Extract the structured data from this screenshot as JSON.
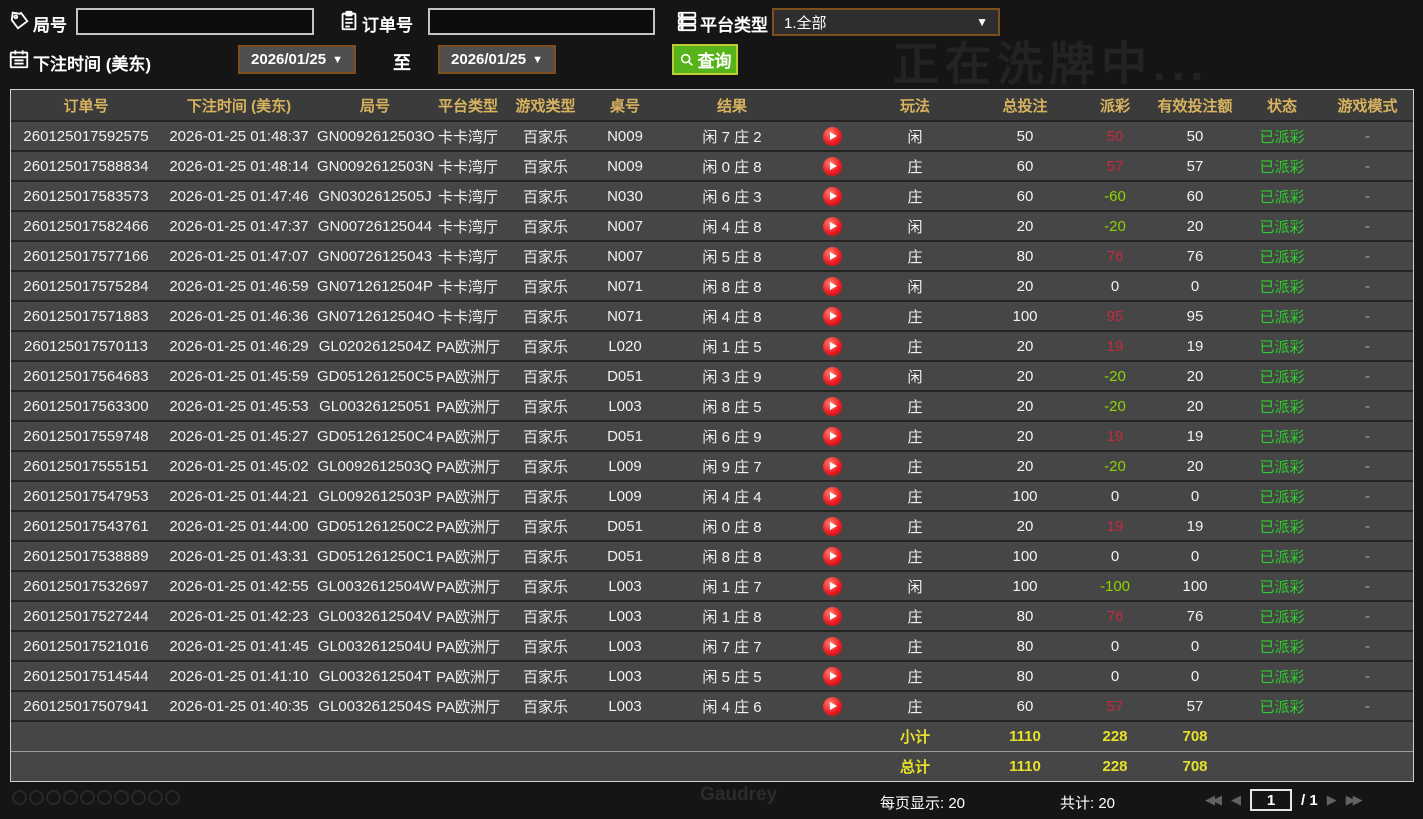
{
  "colors": {
    "positive_payout": "#c62a3e",
    "negative_payout": "#8fd400",
    "status_paid": "#2ecc2e",
    "totals": "#e8e12b",
    "header_text": "#d8b35f",
    "query_button": "#57b31a"
  },
  "watermarks": {
    "top": "正在洗牌中...",
    "bottom": "Gaudrey"
  },
  "filters": {
    "game_no_label": "局号",
    "order_no_label": "订单号",
    "platform_label": "平台类型",
    "platform_value": "1.全部",
    "bet_time_label": "下注时间 (美东)",
    "date_from": "2026/01/25",
    "date_to": "2026/01/25",
    "to_label": "至",
    "query_label": "查询"
  },
  "table": {
    "headers": [
      "订单号",
      "下注时间 (美东)",
      "局号",
      "平台类型",
      "游戏类型",
      "桌号",
      "结果",
      "",
      "玩法",
      "总投注",
      "派彩",
      "有效投注额",
      "状态",
      "游戏模式"
    ],
    "rows": [
      {
        "order_no": "260125017592575",
        "bet_time": "2026-01-25 01:48:37",
        "game_no": "GN0092612503O",
        "platform": "卡卡湾厅",
        "game_type": "百家乐",
        "table_no": "N009",
        "result": "闲 7 庄 2",
        "play": "闲",
        "total_bet": "50",
        "payout": "50",
        "payout_sign": "pos",
        "valid_bet": "50",
        "status": "已派彩",
        "game_mode": "-"
      },
      {
        "order_no": "260125017588834",
        "bet_time": "2026-01-25 01:48:14",
        "game_no": "GN0092612503N",
        "platform": "卡卡湾厅",
        "game_type": "百家乐",
        "table_no": "N009",
        "result": "闲 0 庄 8",
        "play": "庄",
        "total_bet": "60",
        "payout": "57",
        "payout_sign": "pos",
        "valid_bet": "57",
        "status": "已派彩",
        "game_mode": "-"
      },
      {
        "order_no": "260125017583573",
        "bet_time": "2026-01-25 01:47:46",
        "game_no": "GN0302612505J",
        "platform": "卡卡湾厅",
        "game_type": "百家乐",
        "table_no": "N030",
        "result": "闲 6 庄 3",
        "play": "庄",
        "total_bet": "60",
        "payout": "-60",
        "payout_sign": "neg",
        "valid_bet": "60",
        "status": "已派彩",
        "game_mode": "-"
      },
      {
        "order_no": "260125017582466",
        "bet_time": "2026-01-25 01:47:37",
        "game_no": "GN00726125044",
        "platform": "卡卡湾厅",
        "game_type": "百家乐",
        "table_no": "N007",
        "result": "闲 4 庄 8",
        "play": "闲",
        "total_bet": "20",
        "payout": "-20",
        "payout_sign": "neg",
        "valid_bet": "20",
        "status": "已派彩",
        "game_mode": "-"
      },
      {
        "order_no": "260125017577166",
        "bet_time": "2026-01-25 01:47:07",
        "game_no": "GN00726125043",
        "platform": "卡卡湾厅",
        "game_type": "百家乐",
        "table_no": "N007",
        "result": "闲 5 庄 8",
        "play": "庄",
        "total_bet": "80",
        "payout": "76",
        "payout_sign": "pos",
        "valid_bet": "76",
        "status": "已派彩",
        "game_mode": "-"
      },
      {
        "order_no": "260125017575284",
        "bet_time": "2026-01-25 01:46:59",
        "game_no": "GN0712612504P",
        "platform": "卡卡湾厅",
        "game_type": "百家乐",
        "table_no": "N071",
        "result": "闲 8 庄 8",
        "play": "闲",
        "total_bet": "20",
        "payout": "0",
        "payout_sign": "zero",
        "valid_bet": "0",
        "status": "已派彩",
        "game_mode": "-"
      },
      {
        "order_no": "260125017571883",
        "bet_time": "2026-01-25 01:46:36",
        "game_no": "GN0712612504O",
        "platform": "卡卡湾厅",
        "game_type": "百家乐",
        "table_no": "N071",
        "result": "闲 4 庄 8",
        "play": "庄",
        "total_bet": "100",
        "payout": "95",
        "payout_sign": "pos",
        "valid_bet": "95",
        "status": "已派彩",
        "game_mode": "-"
      },
      {
        "order_no": "260125017570113",
        "bet_time": "2026-01-25 01:46:29",
        "game_no": "GL0202612504Z",
        "platform": "PA欧洲厅",
        "game_type": "百家乐",
        "table_no": "L020",
        "result": "闲 1 庄 5",
        "play": "庄",
        "total_bet": "20",
        "payout": "19",
        "payout_sign": "pos",
        "valid_bet": "19",
        "status": "已派彩",
        "game_mode": "-"
      },
      {
        "order_no": "260125017564683",
        "bet_time": "2026-01-25 01:45:59",
        "game_no": "GD051261250C5",
        "platform": "PA欧洲厅",
        "game_type": "百家乐",
        "table_no": "D051",
        "result": "闲 3 庄 9",
        "play": "闲",
        "total_bet": "20",
        "payout": "-20",
        "payout_sign": "neg",
        "valid_bet": "20",
        "status": "已派彩",
        "game_mode": "-"
      },
      {
        "order_no": "260125017563300",
        "bet_time": "2026-01-25 01:45:53",
        "game_no": "GL00326125051",
        "platform": "PA欧洲厅",
        "game_type": "百家乐",
        "table_no": "L003",
        "result": "闲 8 庄 5",
        "play": "庄",
        "total_bet": "20",
        "payout": "-20",
        "payout_sign": "neg",
        "valid_bet": "20",
        "status": "已派彩",
        "game_mode": "-"
      },
      {
        "order_no": "260125017559748",
        "bet_time": "2026-01-25 01:45:27",
        "game_no": "GD051261250C4",
        "platform": "PA欧洲厅",
        "game_type": "百家乐",
        "table_no": "D051",
        "result": "闲 6 庄 9",
        "play": "庄",
        "total_bet": "20",
        "payout": "19",
        "payout_sign": "pos",
        "valid_bet": "19",
        "status": "已派彩",
        "game_mode": "-"
      },
      {
        "order_no": "260125017555151",
        "bet_time": "2026-01-25 01:45:02",
        "game_no": "GL0092612503Q",
        "platform": "PA欧洲厅",
        "game_type": "百家乐",
        "table_no": "L009",
        "result": "闲 9 庄 7",
        "play": "庄",
        "total_bet": "20",
        "payout": "-20",
        "payout_sign": "neg",
        "valid_bet": "20",
        "status": "已派彩",
        "game_mode": "-"
      },
      {
        "order_no": "260125017547953",
        "bet_time": "2026-01-25 01:44:21",
        "game_no": "GL0092612503P",
        "platform": "PA欧洲厅",
        "game_type": "百家乐",
        "table_no": "L009",
        "result": "闲 4 庄 4",
        "play": "庄",
        "total_bet": "100",
        "payout": "0",
        "payout_sign": "zero",
        "valid_bet": "0",
        "status": "已派彩",
        "game_mode": "-"
      },
      {
        "order_no": "260125017543761",
        "bet_time": "2026-01-25 01:44:00",
        "game_no": "GD051261250C2",
        "platform": "PA欧洲厅",
        "game_type": "百家乐",
        "table_no": "D051",
        "result": "闲 0 庄 8",
        "play": "庄",
        "total_bet": "20",
        "payout": "19",
        "payout_sign": "pos",
        "valid_bet": "19",
        "status": "已派彩",
        "game_mode": "-"
      },
      {
        "order_no": "260125017538889",
        "bet_time": "2026-01-25 01:43:31",
        "game_no": "GD051261250C1",
        "platform": "PA欧洲厅",
        "game_type": "百家乐",
        "table_no": "D051",
        "result": "闲 8 庄 8",
        "play": "庄",
        "total_bet": "100",
        "payout": "0",
        "payout_sign": "zero",
        "valid_bet": "0",
        "status": "已派彩",
        "game_mode": "-"
      },
      {
        "order_no": "260125017532697",
        "bet_time": "2026-01-25 01:42:55",
        "game_no": "GL0032612504W",
        "platform": "PA欧洲厅",
        "game_type": "百家乐",
        "table_no": "L003",
        "result": "闲 1 庄 7",
        "play": "闲",
        "total_bet": "100",
        "payout": "-100",
        "payout_sign": "neg",
        "valid_bet": "100",
        "status": "已派彩",
        "game_mode": "-"
      },
      {
        "order_no": "260125017527244",
        "bet_time": "2026-01-25 01:42:23",
        "game_no": "GL0032612504V",
        "platform": "PA欧洲厅",
        "game_type": "百家乐",
        "table_no": "L003",
        "result": "闲 1 庄 8",
        "play": "庄",
        "total_bet": "80",
        "payout": "76",
        "payout_sign": "pos",
        "valid_bet": "76",
        "status": "已派彩",
        "game_mode": "-"
      },
      {
        "order_no": "260125017521016",
        "bet_time": "2026-01-25 01:41:45",
        "game_no": "GL0032612504U",
        "platform": "PA欧洲厅",
        "game_type": "百家乐",
        "table_no": "L003",
        "result": "闲 7 庄 7",
        "play": "庄",
        "total_bet": "80",
        "payout": "0",
        "payout_sign": "zero",
        "valid_bet": "0",
        "status": "已派彩",
        "game_mode": "-"
      },
      {
        "order_no": "260125017514544",
        "bet_time": "2026-01-25 01:41:10",
        "game_no": "GL0032612504T",
        "platform": "PA欧洲厅",
        "game_type": "百家乐",
        "table_no": "L003",
        "result": "闲 5 庄 5",
        "play": "庄",
        "total_bet": "80",
        "payout": "0",
        "payout_sign": "zero",
        "valid_bet": "0",
        "status": "已派彩",
        "game_mode": "-"
      },
      {
        "order_no": "260125017507941",
        "bet_time": "2026-01-25 01:40:35",
        "game_no": "GL0032612504S",
        "platform": "PA欧洲厅",
        "game_type": "百家乐",
        "table_no": "L003",
        "result": "闲 4 庄 6",
        "play": "庄",
        "total_bet": "60",
        "payout": "57",
        "payout_sign": "pos",
        "valid_bet": "57",
        "status": "已派彩",
        "game_mode": "-"
      }
    ],
    "summary": [
      {
        "label": "小计",
        "total_bet": "1110",
        "payout": "228",
        "valid_bet": "708"
      },
      {
        "label": "总计",
        "total_bet": "1110",
        "payout": "228",
        "valid_bet": "708"
      }
    ]
  },
  "footer": {
    "per_page_label": "每页显示: 20",
    "total_label": "共计: 20",
    "page_value": "1",
    "page_total_label": "/  1",
    "first_icon": "◀◀",
    "prev_icon": "◀",
    "next_icon": "▶",
    "last_icon": "▶▶"
  }
}
